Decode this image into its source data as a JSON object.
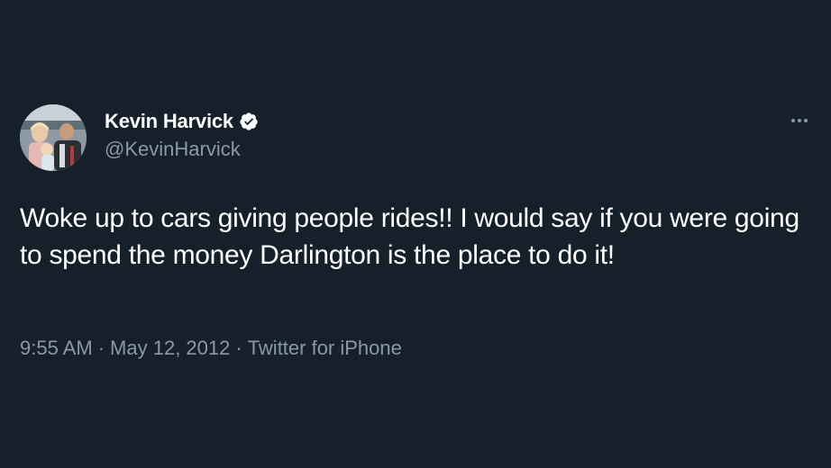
{
  "tweet": {
    "author": {
      "display_name": "Kevin Harvick",
      "handle": "@KevinHarvick",
      "verified": true,
      "avatar_icon": "avatar-photo"
    },
    "text": "Woke up to cars giving people rides!! I would say if you were going to spend the money Darlington is the place to do it!",
    "meta": {
      "time": "9:55 AM",
      "separator": "·",
      "date": "May 12, 2012",
      "source": "Twitter for iPhone"
    },
    "more_icon": "more-horizontal-icon"
  },
  "colors": {
    "background": "#15202b",
    "text_primary": "#ffffff",
    "text_secondary": "#8b98a5",
    "verified_badge": "#ffffff"
  }
}
